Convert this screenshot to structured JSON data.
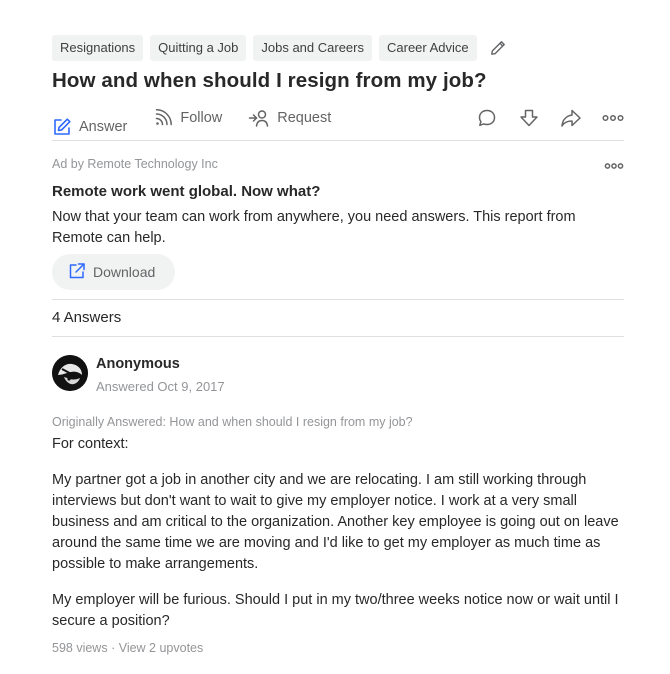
{
  "topics": [
    "Resignations",
    "Quitting a Job",
    "Jobs and Careers",
    "Career Advice"
  ],
  "question": {
    "title": "How and when should I resign from my job?"
  },
  "actions": {
    "answer": "Answer",
    "follow": "Follow",
    "request": "Request"
  },
  "ad": {
    "sponsor": "Ad by Remote Technology Inc",
    "title": "Remote work went global. Now what?",
    "text": "Now that your team can work from anywhere, you need answers. This report from Remote can help.",
    "button": "Download"
  },
  "answers_count": "4 Answers",
  "answer": {
    "author": "Anonymous",
    "date": "Answered Oct 9, 2017",
    "originally": "Originally Answered: How and when should I resign from my job?",
    "paragraphs": [
      "For context:",
      "My partner got a job in another city and we are relocating. I am still working through interviews but don't want to wait to give my employer notice. I work at a very small business and am critical to the organization. Another key employee is going out on leave around the same time we are moving and I'd like to get my employer as much time as possible to make arrangements.",
      "My employer will be furious. Should I put in my two/three weeks notice now or wait until I secure a position?"
    ],
    "views": "598 views",
    "separator": " · ",
    "upvotes": "View 2 upvotes"
  },
  "colors": {
    "accent": "#2e69ff",
    "text": "#282829",
    "muted": "#939598",
    "icon": "#636466",
    "chip_bg": "#f1f2f2",
    "divider": "#dedfe0"
  },
  "icons": [
    "pencil-icon",
    "answer-pen-icon",
    "follow-signal-icon",
    "request-user-icon",
    "comment-icon",
    "downvote-icon",
    "share-icon",
    "more-icon",
    "external-link-icon"
  ]
}
